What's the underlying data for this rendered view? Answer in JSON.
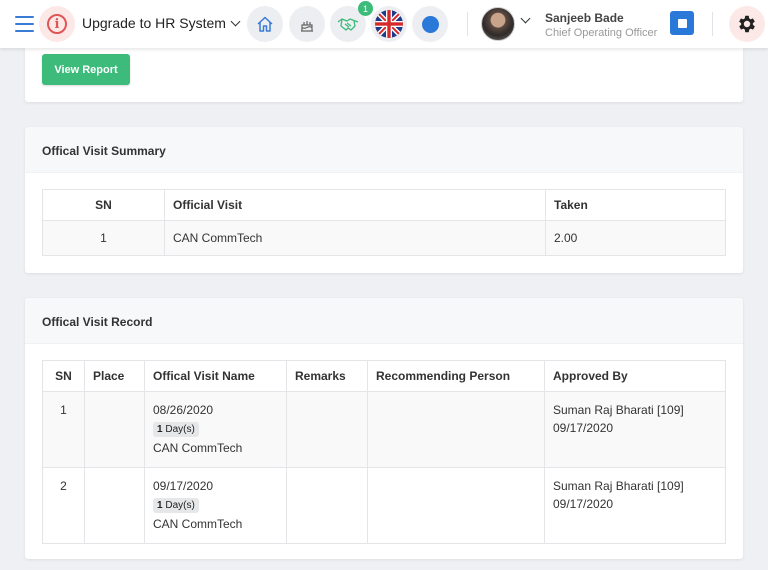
{
  "header": {
    "upgrade_label": "Upgrade to HR System",
    "notification_count": "1",
    "user_name": "Sanjeeb Bade",
    "user_role": "Chief Operating Officer"
  },
  "top_card": {
    "view_report_label": "View Report"
  },
  "summary": {
    "title": "Offical Visit Summary",
    "columns": [
      "SN",
      "Official Visit",
      "Taken"
    ],
    "rows": [
      {
        "sn": "1",
        "visit": "CAN CommTech",
        "taken": "2.00"
      }
    ]
  },
  "record": {
    "title": "Offical Visit Record",
    "columns": [
      "SN",
      "Place",
      "Offical Visit Name",
      "Remarks",
      "Recommending Person",
      "Approved By"
    ],
    "rows": [
      {
        "sn": "1",
        "place": "",
        "date": "08/26/2020",
        "days_num": "1",
        "days_unit": "Day(s)",
        "name": "CAN CommTech",
        "remarks": "",
        "recommending": "",
        "approved_by": "Suman Raj Bharati [109]",
        "approved_date": "09/17/2020"
      },
      {
        "sn": "2",
        "place": "",
        "date": "09/17/2020",
        "days_num": "1",
        "days_unit": "Day(s)",
        "name": "CAN CommTech",
        "remarks": "",
        "recommending": "",
        "approved_by": "Suman Raj Bharati [109]",
        "approved_date": "09/17/2020"
      }
    ]
  },
  "colors": {
    "accent_green": "#3dbb7a",
    "accent_blue": "#2a78d8",
    "alert_red": "#e05555"
  },
  "icons": [
    "hamburger-icon",
    "info-icon",
    "home-icon",
    "cake-icon",
    "handshake-icon",
    "uk-flag-icon",
    "status-dot-icon",
    "calendar-icon",
    "gear-icon"
  ]
}
